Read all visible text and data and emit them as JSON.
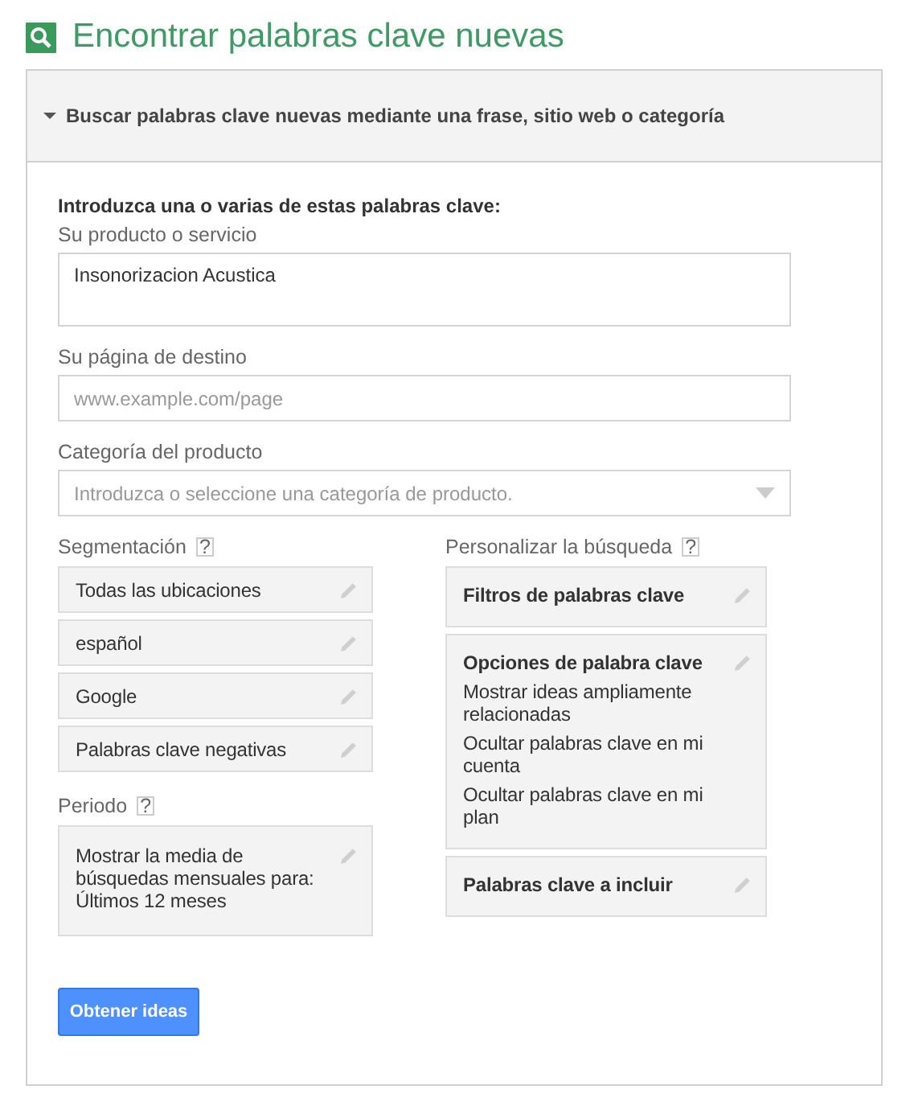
{
  "page_title": "Encontrar palabras clave nuevas",
  "section": {
    "title": "Buscar palabras clave nuevas mediante una frase, sitio web o categoría",
    "expanded": true
  },
  "form": {
    "intro": "Introduzca una o varias de estas palabras clave:",
    "fields": [
      {
        "kind": "textarea",
        "label": "Su producto o servicio",
        "value": "Insonorizacion Acustica"
      },
      {
        "kind": "text",
        "label": "Su página de destino",
        "placeholder": "www.example.com/page"
      },
      {
        "kind": "select",
        "label": "Categoría del producto",
        "placeholder": "Introduzca o seleccione una categoría de producto."
      }
    ]
  },
  "targeting": {
    "label": "Segmentación",
    "help": "?",
    "items": [
      "Todas las ubicaciones",
      "español",
      "Google",
      "Palabras clave negativas"
    ]
  },
  "period": {
    "label": "Periodo",
    "help": "?",
    "lines": [
      "Mostrar la media de búsquedas mensuales para:",
      "Últimos 12 meses"
    ]
  },
  "customize": {
    "label": "Personalizar la búsqueda",
    "help": "?",
    "cards": [
      {
        "title": "Filtros de palabras clave"
      },
      {
        "title": "Opciones de palabra clave",
        "lines": [
          "Mostrar ideas ampliamente relacionadas",
          "Ocultar palabras clave en mi cuenta",
          "Ocultar palabras clave en mi plan"
        ]
      },
      {
        "title": "Palabras clave a incluir"
      }
    ]
  },
  "submit": "Obtener ideas"
}
